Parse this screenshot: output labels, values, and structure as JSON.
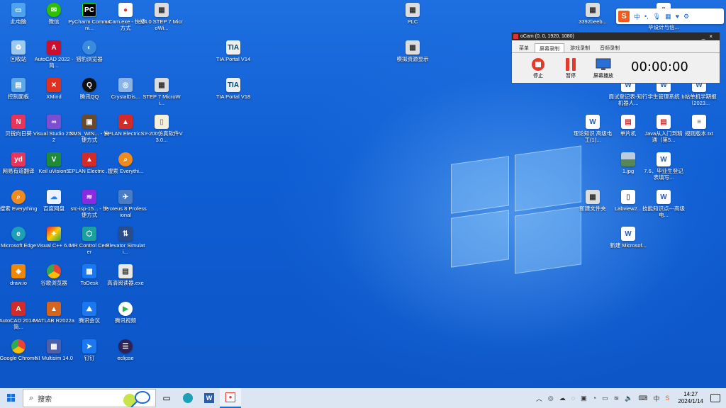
{
  "desktop": {
    "icons": {
      "this_pc": "此电脑",
      "wechat": "微信",
      "pycharm": "PyCharm Communi...",
      "ucam": "uCam.exe - 快捷方式",
      "v4_step7": "V4.0 STEP 7 MicroWi...",
      "recycle": "回收站",
      "autocad2022": "AutoCAD 2022 - 简...",
      "browser_beta": "猎豹浏览器",
      "control_panel": "控制面板",
      "xmind": "XMind",
      "qq": "腾讯QQ",
      "crystaldisk": "CrystalDis...",
      "step7_micro": "STEP 7 MicroWi...",
      "youdao_cloud": "贝锐向日葵",
      "vs2022": "Visual Studio 2022",
      "sms_win": "SMS_WIN... - 快捷方式",
      "eplan1": "EPLAN Electric ...",
      "sy200": "SY-200仿真软件V3.0...",
      "youdao_dict": "网易有道翻译",
      "keil": "Keil uVision5",
      "eplan2": "EPLAN Electric ...",
      "everything2": "搜索 Everythi...",
      "everything1": "搜索 Everything",
      "baidu_pan": "百度网盘",
      "stc_isp": "stc-isp-15... - 快捷方式",
      "proteus": "Proteus 8 Professional",
      "edge": "Microsoft Edge",
      "vc6": "Visual C++ 6.0",
      "mr_control": "MR Control Center",
      "elevator": "Elevator Simulati...",
      "drawio": "draw.io",
      "chrome_cn": "谷歌浏览器",
      "todesk": "ToDesk",
      "pdf_reader": "高清阅读器.exe",
      "autocad2014": "AutoCAD 2014 - 简...",
      "matlab": "MATLAB R2022a",
      "tencent_meeting": "腾讯会议",
      "tencent_video": "腾讯视频",
      "google_chrome": "Google Chrome",
      "multisim": "NI Multisim 14.0",
      "dingding": "钉钉",
      "eclipse": "eclipse",
      "tia14": "TIA Portal V14",
      "tia18": "TIA Portal V18",
      "plc": "PLC",
      "resource_display": "模拟资源显示",
      "file_3392": "3392beeb...",
      "design_final": "毕设计与信...",
      "interview": "面试登记表-知行机器人...",
      "student_system": "学生管理系统",
      "bstation_robot": "b站单机学期报（2023...",
      "theory_doc": "理论知识 高级电工(1)...",
      "mcu": "单片机",
      "java_intro": "Java从入门到精通（第5...",
      "rules_txt": "规则版本.txt",
      "img_1jpg": "1.jpg",
      "graduation": "7.6、毕业生登记表填写...",
      "new_folder": "新建文件夹",
      "labview": "Labview2...",
      "skill_doc": "技能知识点---高级电...",
      "new_ms": "新建 Microsof..."
    }
  },
  "ocam": {
    "title": "oCam (0, 0, 1920, 1080)",
    "tabs": [
      "菜单",
      "屏幕录制",
      "游戏录制",
      "音频录制"
    ],
    "stop_label": "停止",
    "pause_label": "暂停",
    "screen_label": "屏幕播放",
    "timer": "00:00:00"
  },
  "ime": {
    "logo": "S",
    "lang": "中"
  },
  "taskbar": {
    "search_placeholder": "搜索",
    "time": "14:27",
    "date": "2024/1/14",
    "ime_indicator": "中"
  },
  "colors": {
    "accent": "#1c6cd6",
    "desktop": "#0f5ed3",
    "taskbar": "#dce6f2"
  }
}
